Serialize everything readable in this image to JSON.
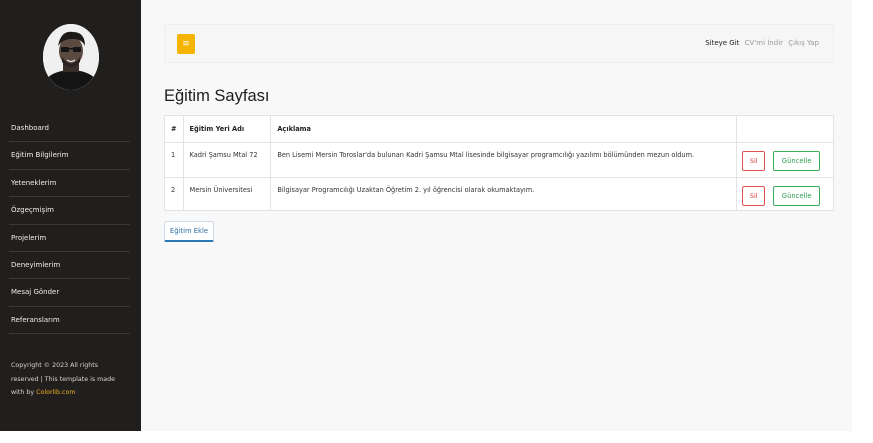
{
  "sidebar": {
    "avatar_alt": "profile photo",
    "items": [
      {
        "label": "Dashboard"
      },
      {
        "label": "Eğitim Bilgilerim"
      },
      {
        "label": "Yeteneklerim"
      },
      {
        "label": "Özgeçmişim"
      },
      {
        "label": "Projelerim"
      },
      {
        "label": "Deneyimlerim"
      },
      {
        "label": "Mesaj Gönder"
      },
      {
        "label": "Referanslarım"
      }
    ],
    "footer": {
      "line1": "Copyright © 2023 All rights",
      "line2": "reserved | This template is made",
      "line3_prefix": "with by ",
      "line3_link": "Colorlib.com"
    }
  },
  "topbar": {
    "toggle_icon": "≡",
    "links": {
      "site": "Siteye Git",
      "cv": "CV'mi İndir",
      "logout": "Çıkış Yap"
    }
  },
  "page": {
    "title": "Eğitim Sayfası"
  },
  "table": {
    "headers": {
      "num": "#",
      "name": "Eğitim Yeri Adı",
      "desc": "Açıklama",
      "actions": ""
    },
    "rows": [
      {
        "num": "1",
        "name": "Kadri Şamsu Mtal 72",
        "desc": "Ben Lisemi Mersin Toroslar'da bulunan Kadri Şamsu Mtal lisesinde bilgisayar programcılığı yazılımı bölümünden mezun oldum.",
        "delete": "Sil",
        "update": "Güncelle"
      },
      {
        "num": "2",
        "name": "Mersin Üniversitesi",
        "desc": "Bilgisayar Programcılığı Uzaktan Öğretim 2. yıl öğrencisi olarak okumaktayım.",
        "delete": "Sil",
        "update": "Güncelle"
      }
    ]
  },
  "actions": {
    "add_label": "Eğitim Ekle"
  },
  "colors": {
    "sidebar": "#211f1d",
    "accent": "#f4b400",
    "danger": "#d93b3b",
    "success": "#2f9e4f",
    "primary": "#2a7ab8"
  }
}
